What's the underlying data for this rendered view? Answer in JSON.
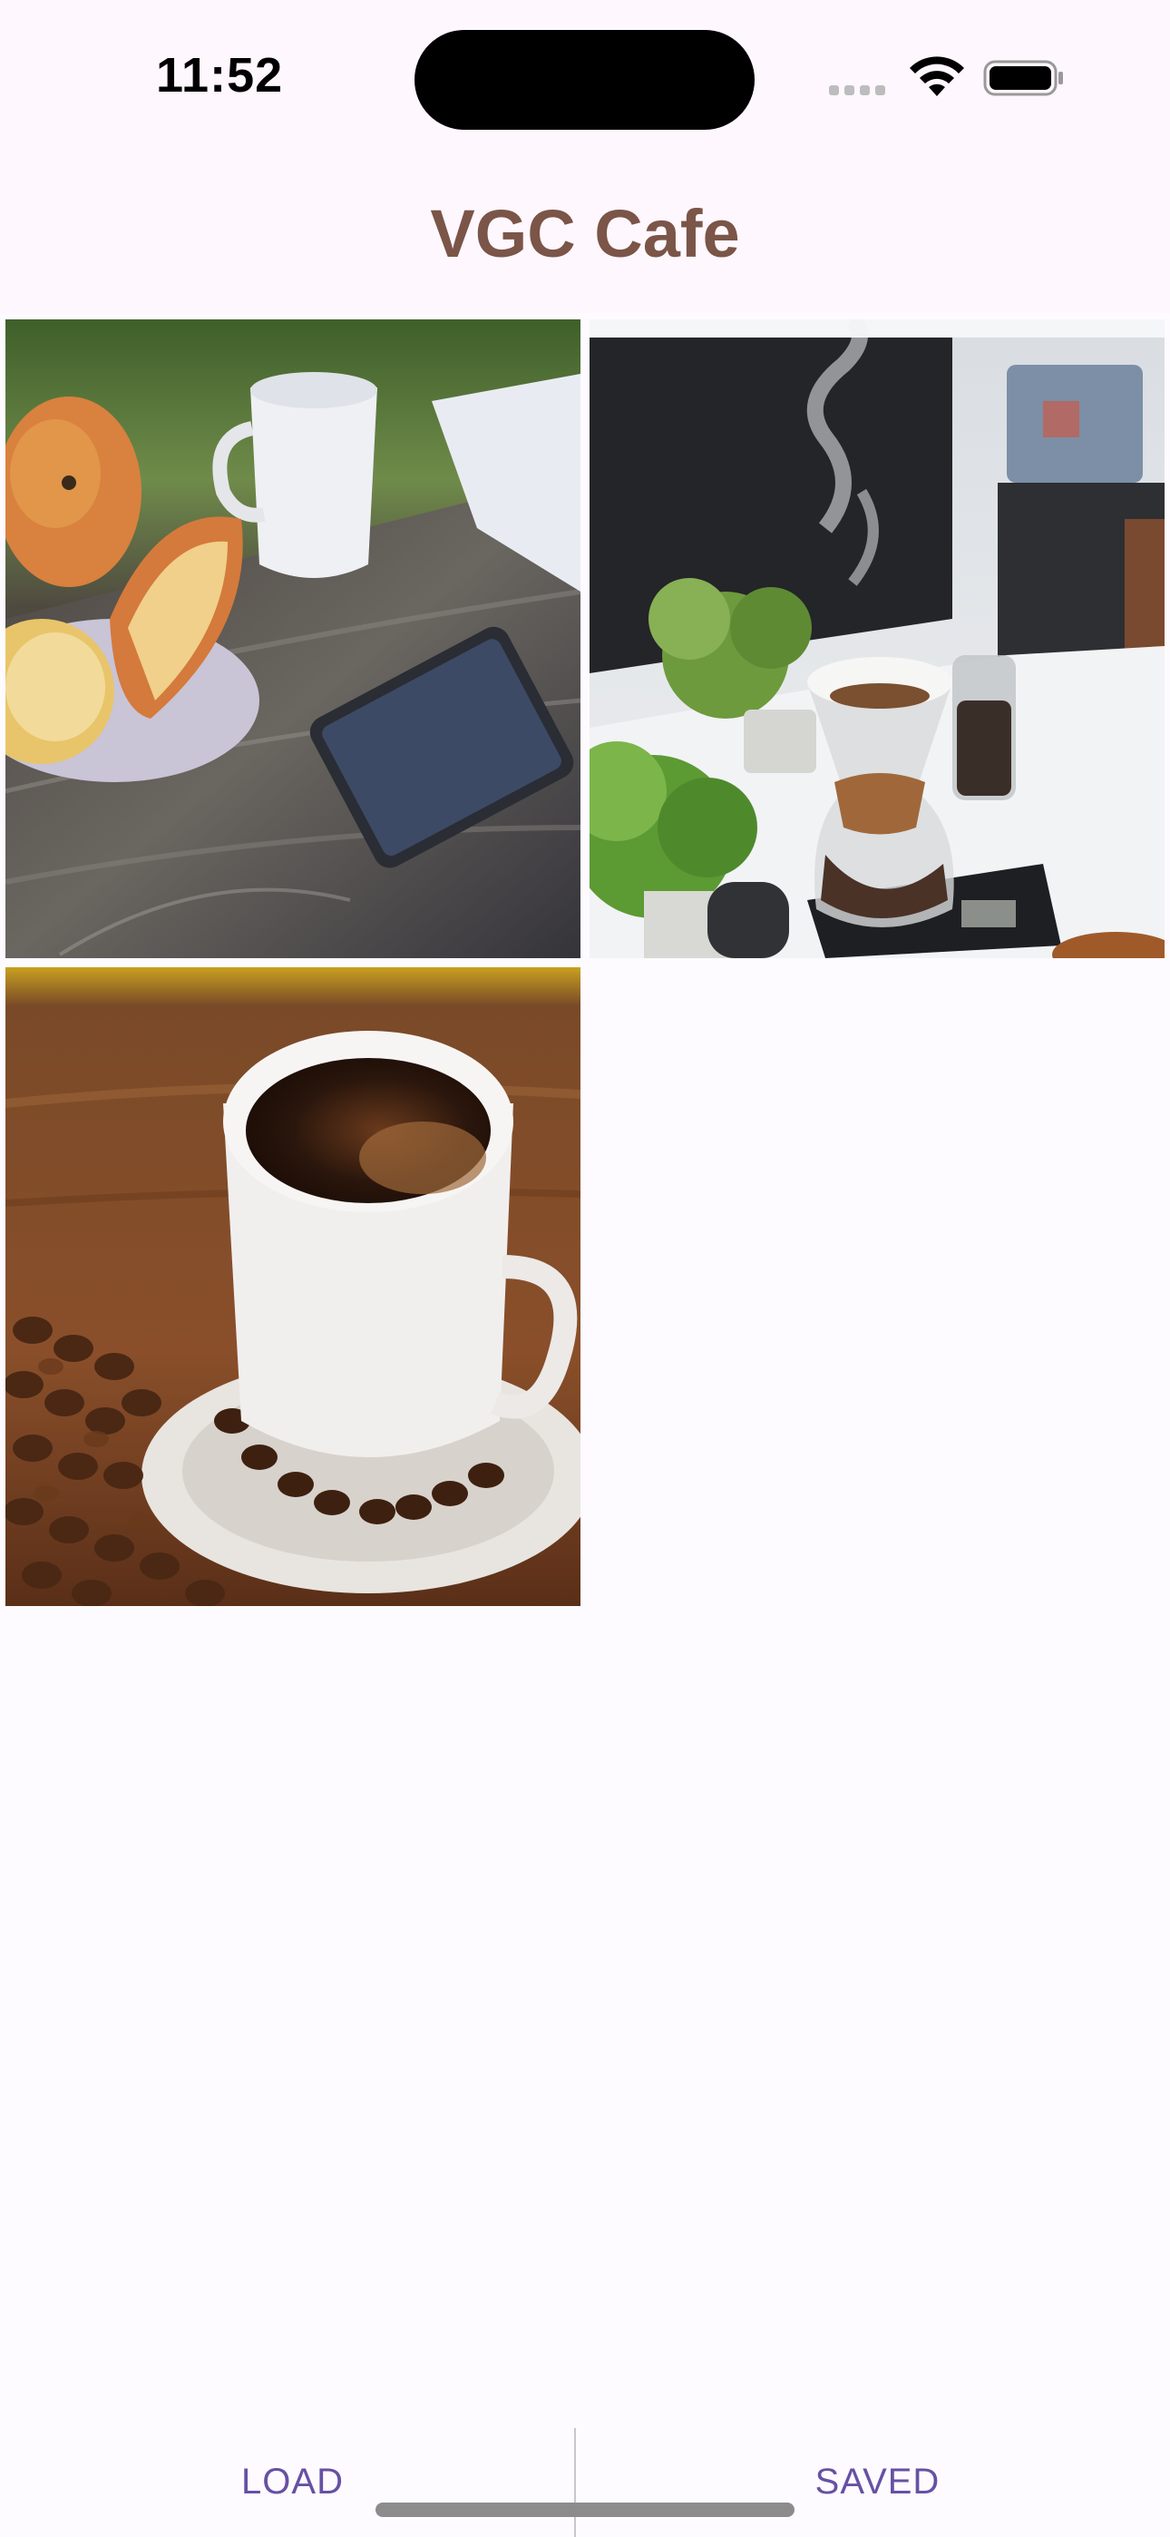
{
  "status_bar": {
    "time": "11:52"
  },
  "header": {
    "title": "VGC Cafe",
    "title_color": "#7a5548"
  },
  "gallery": {
    "images": [
      {
        "description_icon": "apples-coffee-phone-photo"
      },
      {
        "description_icon": "pour-over-coffee-plants-photo"
      },
      {
        "description_icon": "coffee-cup-beans-photo"
      }
    ]
  },
  "bottom_bar": {
    "load_label": "LOAD",
    "saved_label": "SAVED",
    "accent_color": "#6750a4"
  }
}
